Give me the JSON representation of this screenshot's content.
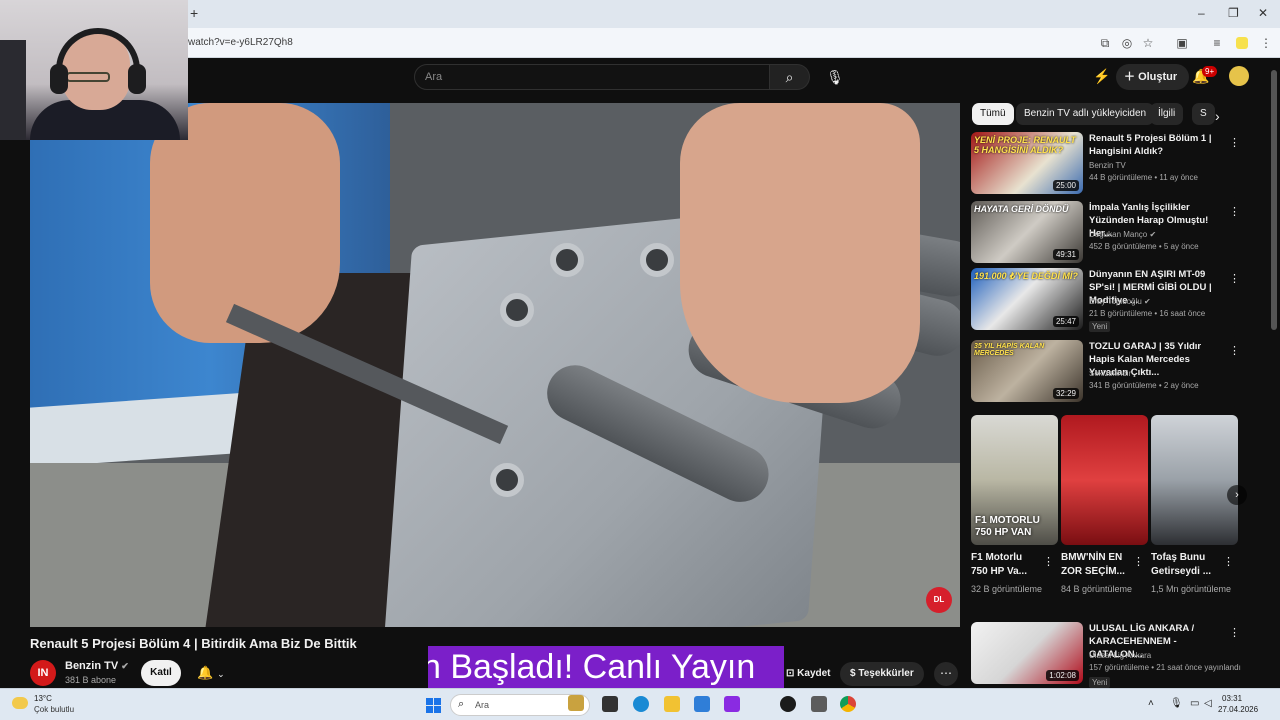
{
  "browser": {
    "new_tab": "+",
    "url": "watch?v=e-y6LR27Qh8",
    "win_min": "–",
    "win_max": "❐",
    "win_close": "✕"
  },
  "masthead": {
    "search_placeholder": "Ara",
    "create_label": "Oluştur",
    "notif_count": "9+"
  },
  "video": {
    "title": "Renault 5 Projesi Bölüm 4 | Bitirdik Ama Biz De Bittik",
    "channel": "Benzin TV",
    "subscribers": "381 B abone",
    "channel_avatar_text": "IN",
    "join_label": "Katıl",
    "live_banner": "n Başladı! Canlı Yayın",
    "save_label": "Kaydet",
    "thanks_label": "Teşekkürler",
    "logo_text": "DL"
  },
  "sidebar": {
    "chips": [
      "Tümü",
      "Benzin TV adlı yükleyiciden",
      "İlgili",
      "S"
    ],
    "recs": [
      {
        "title": "Renault 5 Projesi Bölüm 1 | Hangisini Aldık?",
        "channel": "Benzin TV",
        "meta": "44 B görüntüleme • 11 ay önce",
        "duration": "25:00",
        "overlay": "YENİ PROJE: RENAULT 5 HANGİSİNİ ALDIK?",
        "new": ""
      },
      {
        "title": "İmpala Yanlış İşçilikler Yüzünden Harap Olmuştu! Her...",
        "channel": "Doğukan Manço",
        "meta": "452 B görüntüleme • 5 ay önce",
        "duration": "49:31",
        "overlay": "HAYATA GERİ DÖNDÜ",
        "new": ""
      },
      {
        "title": "Dünyanın EN AŞIRI MT-09 SP'si! | MERMİ GİBİ OLDU | Modifiye ...",
        "channel": "Eray Topluoğlu",
        "meta": "21 B görüntüleme • 16 saat önce",
        "duration": "25:47",
        "overlay": "191.000 ₺'YE DEĞDİ Mİ?",
        "new": "Yeni"
      },
      {
        "title": "TOZLU GARAJ | 35 Yıldır Hapis Kalan Mercedes Yuvadan Çıktı...",
        "channel": "Sekizsilindir",
        "meta": "341 B görüntüleme • 2 ay önce",
        "duration": "32:29",
        "overlay": "35 YIL HAPİS KALAN MERCEDES",
        "new": ""
      },
      {
        "title": "ULUSAL LİG ANKARA / KARACEHENNEM - GATALON...",
        "channel": "Ulusal Lig Ankara",
        "meta": "157 görüntüleme • 21 saat önce yayınlandı",
        "duration": "1:02:08",
        "overlay": "",
        "new": "Yeni"
      }
    ],
    "shorts": [
      {
        "title": "F1 Motorlu 750 HP Va...",
        "views": "32 B görüntüleme",
        "caption": "F1 MOTORLU 750 HP VAN"
      },
      {
        "title": "BMW'NİN EN ZOR SEÇİM...",
        "views": "84 B görüntüleme",
        "caption": ""
      },
      {
        "title": "Tofaş Bunu Getirseydi ...",
        "views": "1,5 Mn görüntüleme",
        "caption": ""
      }
    ]
  },
  "taskbar": {
    "temp": "13°C",
    "condition": "Çok bulutlu",
    "search": "Ara",
    "time": "03:31",
    "date": "27.04.2026"
  }
}
